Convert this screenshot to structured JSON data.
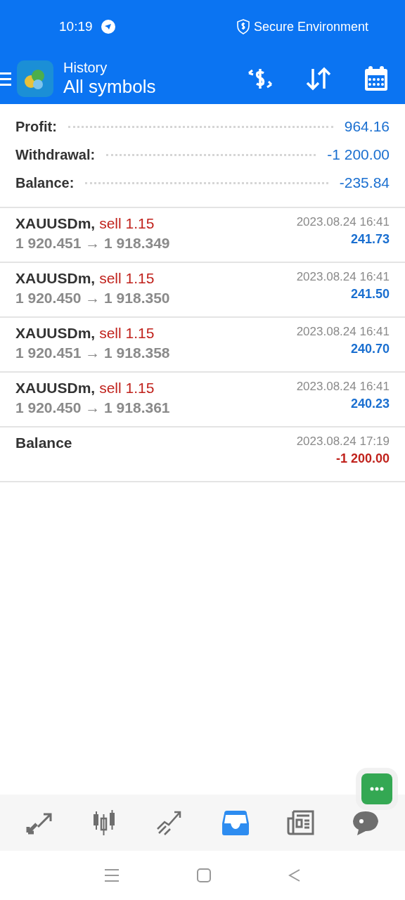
{
  "status_bar": {
    "time": "10:19",
    "secure": "Secure Environment"
  },
  "header": {
    "title": "History",
    "subtitle": "All symbols"
  },
  "summary": [
    {
      "label": "Profit:",
      "value": "964.16"
    },
    {
      "label": "Withdrawal:",
      "value": "-1 200.00"
    },
    {
      "label": "Balance:",
      "value": "-235.84"
    }
  ],
  "deals": [
    {
      "kind": "trade",
      "symbol": "XAUUSDm,",
      "side": "sell 1.15",
      "prices": "1 920.451 → 1 918.349",
      "time": "2023.08.24 16:41",
      "amount": "241.73",
      "loss": false
    },
    {
      "kind": "trade",
      "symbol": "XAUUSDm,",
      "side": "sell 1.15",
      "prices": "1 920.450 → 1 918.350",
      "time": "2023.08.24 16:41",
      "amount": "241.50",
      "loss": false
    },
    {
      "kind": "trade",
      "symbol": "XAUUSDm,",
      "side": "sell 1.15",
      "prices": "1 920.451 → 1 918.358",
      "time": "2023.08.24 16:41",
      "amount": "240.70",
      "loss": false
    },
    {
      "kind": "trade",
      "symbol": "XAUUSDm,",
      "side": "sell 1.15",
      "prices": "1 920.450 → 1 918.361",
      "time": "2023.08.24 16:41",
      "amount": "240.23",
      "loss": false
    },
    {
      "kind": "balance",
      "symbol": "Balance",
      "time": "2023.08.24 17:19",
      "amount": "-1 200.00",
      "loss": true
    }
  ],
  "tabs": [
    {
      "kind": "trade",
      "selected": false
    },
    {
      "kind": "quotes",
      "selected": false
    },
    {
      "kind": "chart",
      "selected": false
    },
    {
      "kind": "history",
      "selected": true
    },
    {
      "kind": "news",
      "selected": false
    },
    {
      "kind": "chat",
      "selected": false
    }
  ]
}
